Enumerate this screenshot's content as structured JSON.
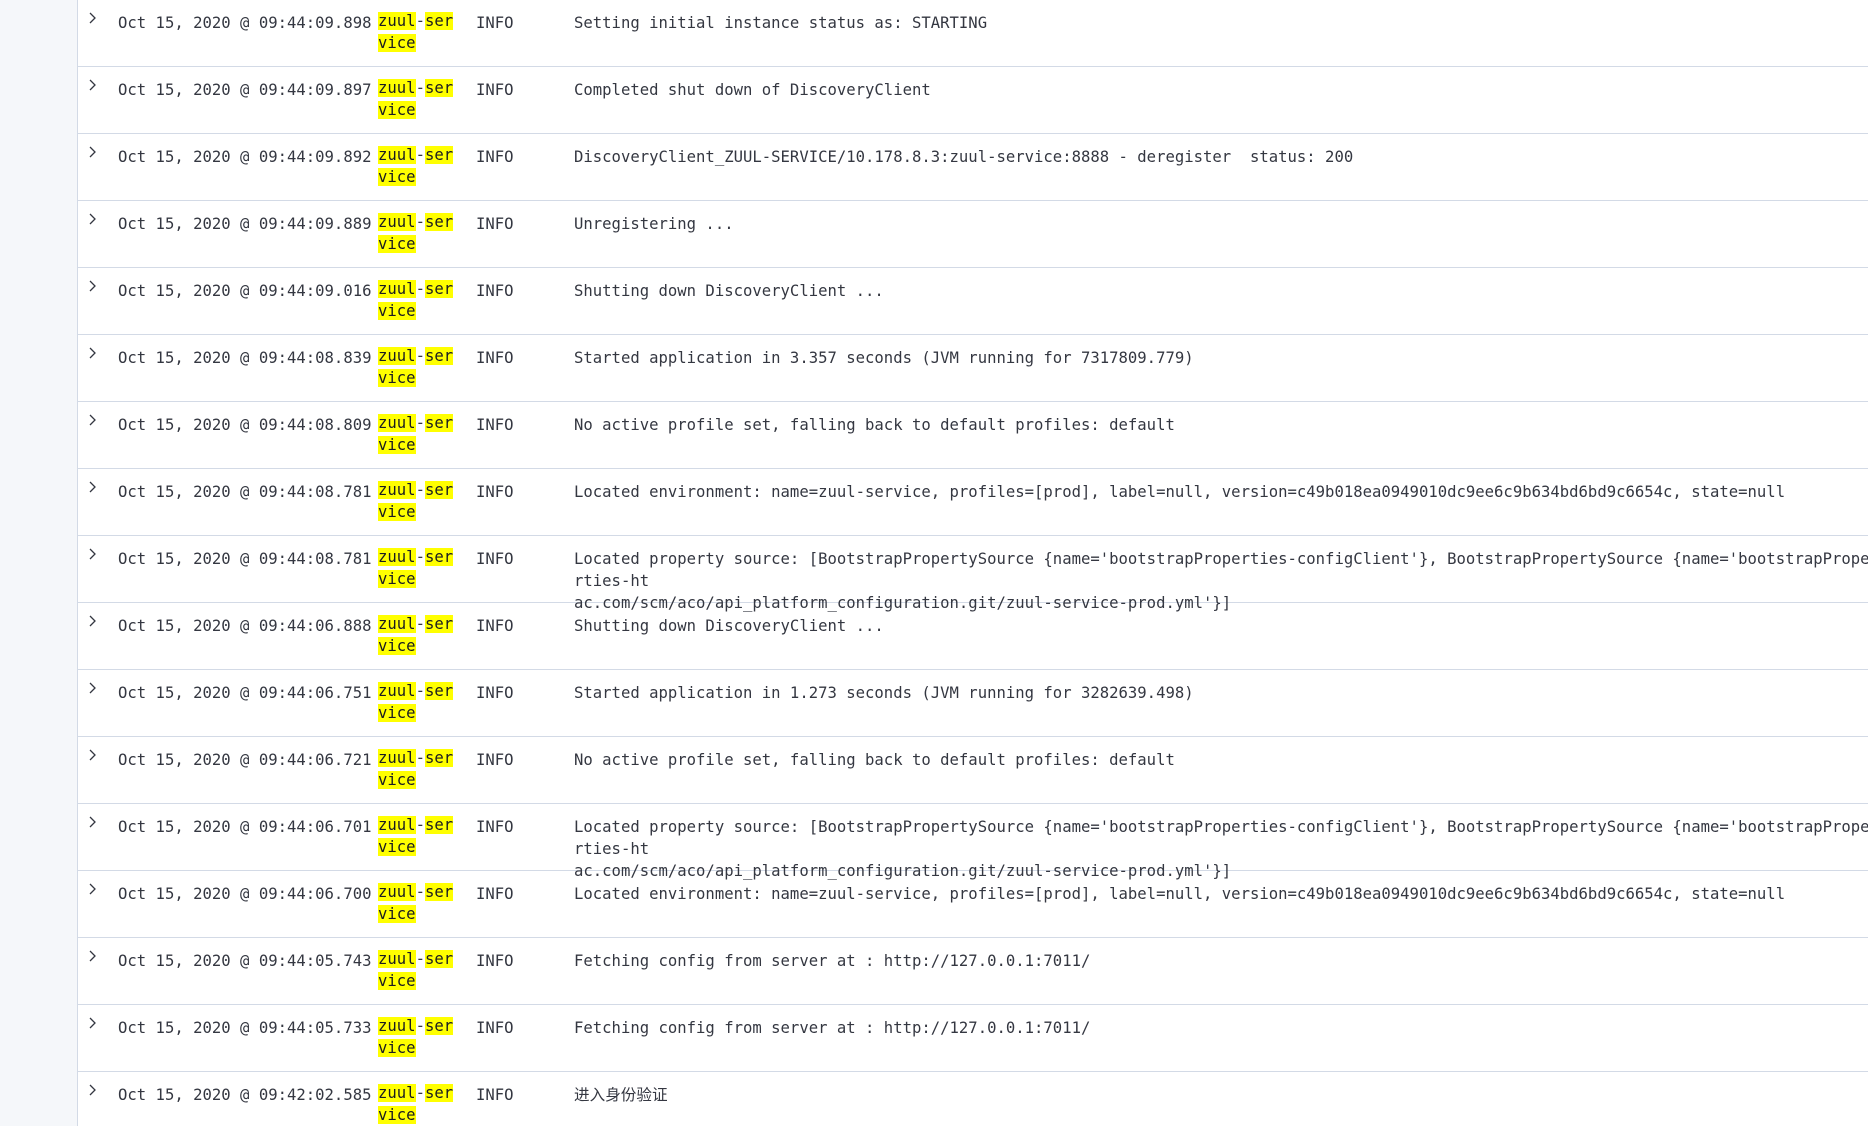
{
  "rows": [
    {
      "ts": "Oct 15, 2020 @ 09:44:09.898",
      "svc_hl1": "zuul",
      "svc_mid": "-",
      "svc_hl2": "ser",
      "svc_hl3": "vice",
      "level": "INFO",
      "message": "Setting initial instance status as: STARTING"
    },
    {
      "ts": "Oct 15, 2020 @ 09:44:09.897",
      "svc_hl1": "zuul",
      "svc_mid": "-",
      "svc_hl2": "ser",
      "svc_hl3": "vice",
      "level": "INFO",
      "message": "Completed shut down of DiscoveryClient"
    },
    {
      "ts": "Oct 15, 2020 @ 09:44:09.892",
      "svc_hl1": "zuul",
      "svc_mid": "-",
      "svc_hl2": "ser",
      "svc_hl3": "vice",
      "level": "INFO",
      "message": "DiscoveryClient_ZUUL-SERVICE/10.178.8.3:zuul-service:8888 - deregister  status: 200"
    },
    {
      "ts": "Oct 15, 2020 @ 09:44:09.889",
      "svc_hl1": "zuul",
      "svc_mid": "-",
      "svc_hl2": "ser",
      "svc_hl3": "vice",
      "level": "INFO",
      "message": "Unregistering ..."
    },
    {
      "ts": "Oct 15, 2020 @ 09:44:09.016",
      "svc_hl1": "zuul",
      "svc_mid": "-",
      "svc_hl2": "ser",
      "svc_hl3": "vice",
      "level": "INFO",
      "message": "Shutting down DiscoveryClient ..."
    },
    {
      "ts": "Oct 15, 2020 @ 09:44:08.839",
      "svc_hl1": "zuul",
      "svc_mid": "-",
      "svc_hl2": "ser",
      "svc_hl3": "vice",
      "level": "INFO",
      "message": "Started application in 3.357 seconds (JVM running for 7317809.779)"
    },
    {
      "ts": "Oct 15, 2020 @ 09:44:08.809",
      "svc_hl1": "zuul",
      "svc_mid": "-",
      "svc_hl2": "ser",
      "svc_hl3": "vice",
      "level": "INFO",
      "message": "No active profile set, falling back to default profiles: default"
    },
    {
      "ts": "Oct 15, 2020 @ 09:44:08.781",
      "svc_hl1": "zuul",
      "svc_mid": "-",
      "svc_hl2": "ser",
      "svc_hl3": "vice",
      "level": "INFO",
      "message": "Located environment: name=zuul-service, profiles=[prod], label=null, version=c49b018ea0949010dc9ee6c9b634bd6bd9c6654c, state=null"
    },
    {
      "ts": "Oct 15, 2020 @ 09:44:08.781",
      "svc_hl1": "zuul",
      "svc_mid": "-",
      "svc_hl2": "ser",
      "svc_hl3": "vice",
      "level": "INFO",
      "message": "Located property source: [BootstrapPropertySource {name='bootstrapProperties-configClient'}, BootstrapPropertySource {name='bootstrapProperties-ht\nac.com/scm/aco/api_platform_configuration.git/zuul-service-prod.yml'}]"
    },
    {
      "ts": "Oct 15, 2020 @ 09:44:06.888",
      "svc_hl1": "zuul",
      "svc_mid": "-",
      "svc_hl2": "ser",
      "svc_hl3": "vice",
      "level": "INFO",
      "message": "Shutting down DiscoveryClient ..."
    },
    {
      "ts": "Oct 15, 2020 @ 09:44:06.751",
      "svc_hl1": "zuul",
      "svc_mid": "-",
      "svc_hl2": "ser",
      "svc_hl3": "vice",
      "level": "INFO",
      "message": "Started application in 1.273 seconds (JVM running for 3282639.498)"
    },
    {
      "ts": "Oct 15, 2020 @ 09:44:06.721",
      "svc_hl1": "zuul",
      "svc_mid": "-",
      "svc_hl2": "ser",
      "svc_hl3": "vice",
      "level": "INFO",
      "message": "No active profile set, falling back to default profiles: default"
    },
    {
      "ts": "Oct 15, 2020 @ 09:44:06.701",
      "svc_hl1": "zuul",
      "svc_mid": "-",
      "svc_hl2": "ser",
      "svc_hl3": "vice",
      "level": "INFO",
      "message": "Located property source: [BootstrapPropertySource {name='bootstrapProperties-configClient'}, BootstrapPropertySource {name='bootstrapProperties-ht\nac.com/scm/aco/api_platform_configuration.git/zuul-service-prod.yml'}]"
    },
    {
      "ts": "Oct 15, 2020 @ 09:44:06.700",
      "svc_hl1": "zuul",
      "svc_mid": "-",
      "svc_hl2": "ser",
      "svc_hl3": "vice",
      "level": "INFO",
      "message": "Located environment: name=zuul-service, profiles=[prod], label=null, version=c49b018ea0949010dc9ee6c9b634bd6bd9c6654c, state=null"
    },
    {
      "ts": "Oct 15, 2020 @ 09:44:05.743",
      "svc_hl1": "zuul",
      "svc_mid": "-",
      "svc_hl2": "ser",
      "svc_hl3": "vice",
      "level": "INFO",
      "message": "Fetching config from server at : http://127.0.0.1:7011/"
    },
    {
      "ts": "Oct 15, 2020 @ 09:44:05.733",
      "svc_hl1": "zuul",
      "svc_mid": "-",
      "svc_hl2": "ser",
      "svc_hl3": "vice",
      "level": "INFO",
      "message": "Fetching config from server at : http://127.0.0.1:7011/"
    },
    {
      "ts": "Oct 15, 2020 @ 09:42:02.585",
      "svc_hl1": "zuul",
      "svc_mid": "-",
      "svc_hl2": "ser",
      "svc_hl3": "vice",
      "level": "INFO",
      "message": "进入身份验证"
    }
  ],
  "colors": {
    "highlight": "#ffff00",
    "border": "#d3dae6",
    "text": "#343741",
    "rail": "#f5f7fa"
  },
  "icons": {
    "row_toggle": "chevron-right-icon"
  }
}
